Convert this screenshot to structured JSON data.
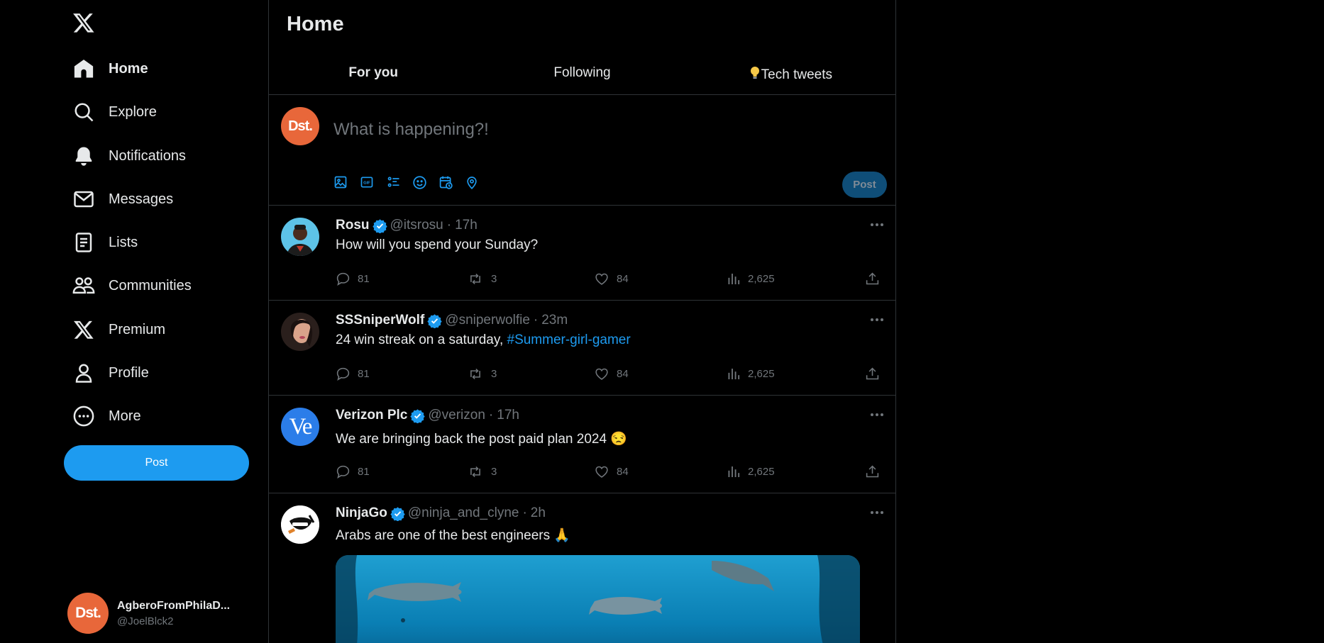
{
  "sidebar": {
    "nav": [
      {
        "label": "Home",
        "icon": "home-icon",
        "active": true
      },
      {
        "label": "Explore",
        "icon": "search-icon"
      },
      {
        "label": "Notifications",
        "icon": "bell-icon"
      },
      {
        "label": "Messages",
        "icon": "mail-icon"
      },
      {
        "label": "Lists",
        "icon": "list-icon"
      },
      {
        "label": "Communities",
        "icon": "people-icon"
      },
      {
        "label": "Premium",
        "icon": "x-logo-icon"
      },
      {
        "label": "Profile",
        "icon": "person-icon"
      },
      {
        "label": "More",
        "icon": "more-circle-icon"
      }
    ],
    "post_label": "Post",
    "account": {
      "name": "AgberoFromPhilaD...",
      "handle": "@JoelBlck2",
      "avatar_text": "Dst."
    }
  },
  "header": {
    "title": "Home",
    "tabs": [
      {
        "label": "For you",
        "active": true
      },
      {
        "label": "Following"
      },
      {
        "label": "Tech tweets",
        "prefix_icon": "lightbulb-icon"
      }
    ]
  },
  "composer": {
    "avatar_text": "Dst.",
    "placeholder": "What is happening?!",
    "tools": [
      "image-icon",
      "gif-icon",
      "poll-icon",
      "emoji-icon",
      "schedule-icon",
      "location-icon"
    ],
    "post_label": "Post"
  },
  "tweets": [
    {
      "name": "Rosu",
      "handle": "@itsrosu",
      "time": "17h",
      "text": "How will you spend your Sunday?",
      "hashtag": "",
      "replies": "81",
      "reposts": "3",
      "likes": "84",
      "views": "2,625"
    },
    {
      "name": "SSSniperWolf",
      "handle": "@sniperwolfie",
      "time": "23m",
      "text": "24 win streak on a saturday, ",
      "hashtag": "#Summer-girl-gamer",
      "replies": "81",
      "reposts": "3",
      "likes": "84",
      "views": "2,625"
    },
    {
      "name": "Verizon Plc",
      "handle": "@verizon",
      "time": "17h",
      "text": "We are bringing back the post paid plan 2024 😒",
      "hashtag": "",
      "replies": "81",
      "reposts": "3",
      "likes": "84",
      "views": "2,625",
      "avatar_text": "Ve"
    },
    {
      "name": "NinjaGo",
      "handle": "@ninja_and_clyne",
      "time": "2h",
      "text": "Arabs are one of the best engineers 🙏",
      "hashtag": ""
    }
  ],
  "colors": {
    "accent": "#1d9bf0",
    "avatar_orange": "#e8673a",
    "muted": "#71767b",
    "border": "#2f3336"
  }
}
